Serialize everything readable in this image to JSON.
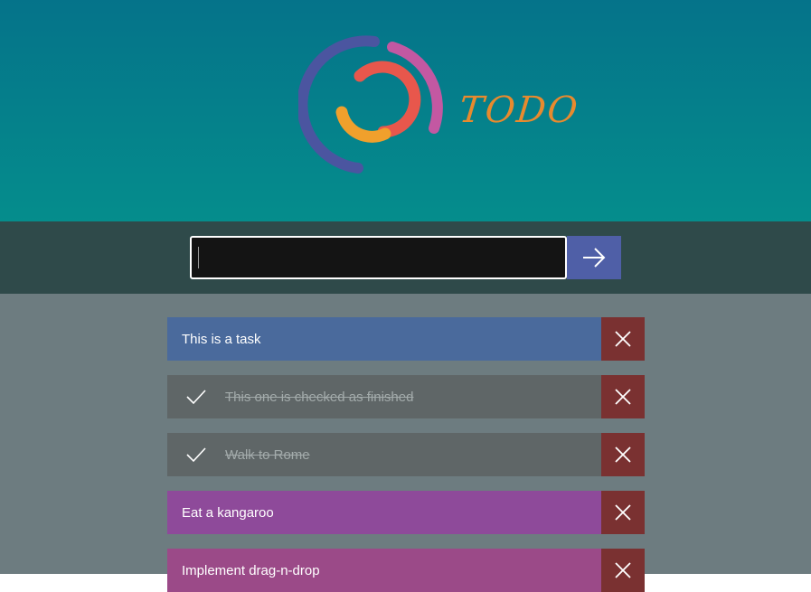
{
  "app": {
    "logo_text": "TODO"
  },
  "input": {
    "value": "",
    "placeholder": ""
  },
  "colors": {
    "header_top": "#05738a",
    "header_bottom": "#058d8c",
    "input_band": "#2f4a4a",
    "list_background": "#6d7c80",
    "submit_button": "#4f5fa7",
    "delete_button": "#7a3131",
    "logo_text": "#e88a2e"
  },
  "tasks": [
    {
      "label": "This is a task",
      "done": false,
      "color": "#4a6a9c"
    },
    {
      "label": "This one is checked as finished",
      "done": true,
      "color": "#5f6667"
    },
    {
      "label": "Walk to Rome",
      "done": true,
      "color": "#5f6667"
    },
    {
      "label": "Eat a kangaroo",
      "done": false,
      "color": "#8e4a9a"
    },
    {
      "label": "Implement drag-n-drop",
      "done": false,
      "color": "#9b4a88"
    }
  ],
  "icons": {
    "submit": "arrow-right-icon",
    "delete": "close-icon",
    "done": "checkmark-icon",
    "logo": "circular-rings-logo"
  }
}
